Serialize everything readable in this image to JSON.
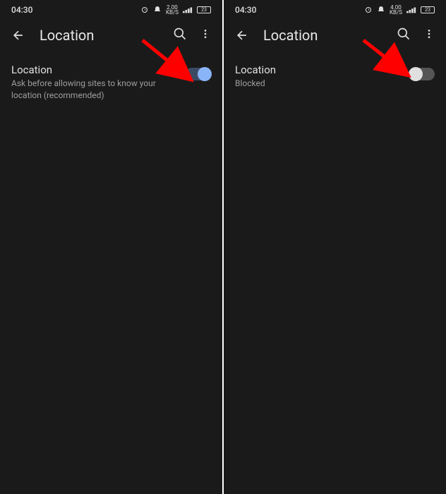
{
  "screens": {
    "left": {
      "statusBar": {
        "time": "04:30",
        "dataRate": "2.00",
        "dataUnit": "KB/S",
        "batteryLevel": "23"
      },
      "appBar": {
        "title": "Location"
      },
      "setting": {
        "title": "Location",
        "subtitle": "Ask before allowing sites to know your location (recommended)",
        "toggleState": "on"
      }
    },
    "right": {
      "statusBar": {
        "time": "04:30",
        "dataRate": "4.00",
        "dataUnit": "KB/S",
        "batteryLevel": "23"
      },
      "appBar": {
        "title": "Location"
      },
      "setting": {
        "title": "Location",
        "subtitle": "Blocked",
        "toggleState": "off"
      }
    }
  },
  "colors": {
    "background": "#1a1a1a",
    "text": "#e0e0e0",
    "subtext": "#9e9e9e",
    "toggleOn": "#8ab4f8",
    "toggleOnTrack": "#3b4a63",
    "arrowAnnotation": "#ff0000"
  }
}
